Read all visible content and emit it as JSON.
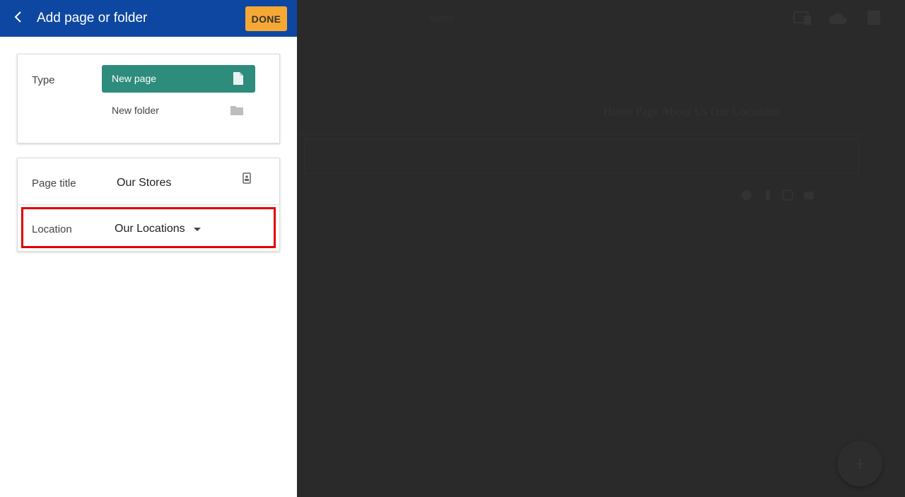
{
  "header": {
    "title": "Add page or folder",
    "done_label": "DONE"
  },
  "type_section": {
    "label": "Type",
    "options": [
      {
        "label": "New page",
        "icon": "page-icon",
        "selected": true
      },
      {
        "label": "New folder",
        "icon": "folder-icon",
        "selected": false
      }
    ]
  },
  "page_section": {
    "title_label": "Page title",
    "title_value": "Our Stores",
    "location_label": "Location",
    "location_value": "Our Locations"
  },
  "background": {
    "topbar_text": "Home",
    "nav_text": "Home Page   About Us   Our Locations"
  },
  "colors": {
    "header_bg": "#0d47a1",
    "done_bg": "#f6a834",
    "selected_option_bg": "#2e8c7c",
    "highlight_border": "#e00000",
    "backdrop": "#2a2a2a"
  }
}
